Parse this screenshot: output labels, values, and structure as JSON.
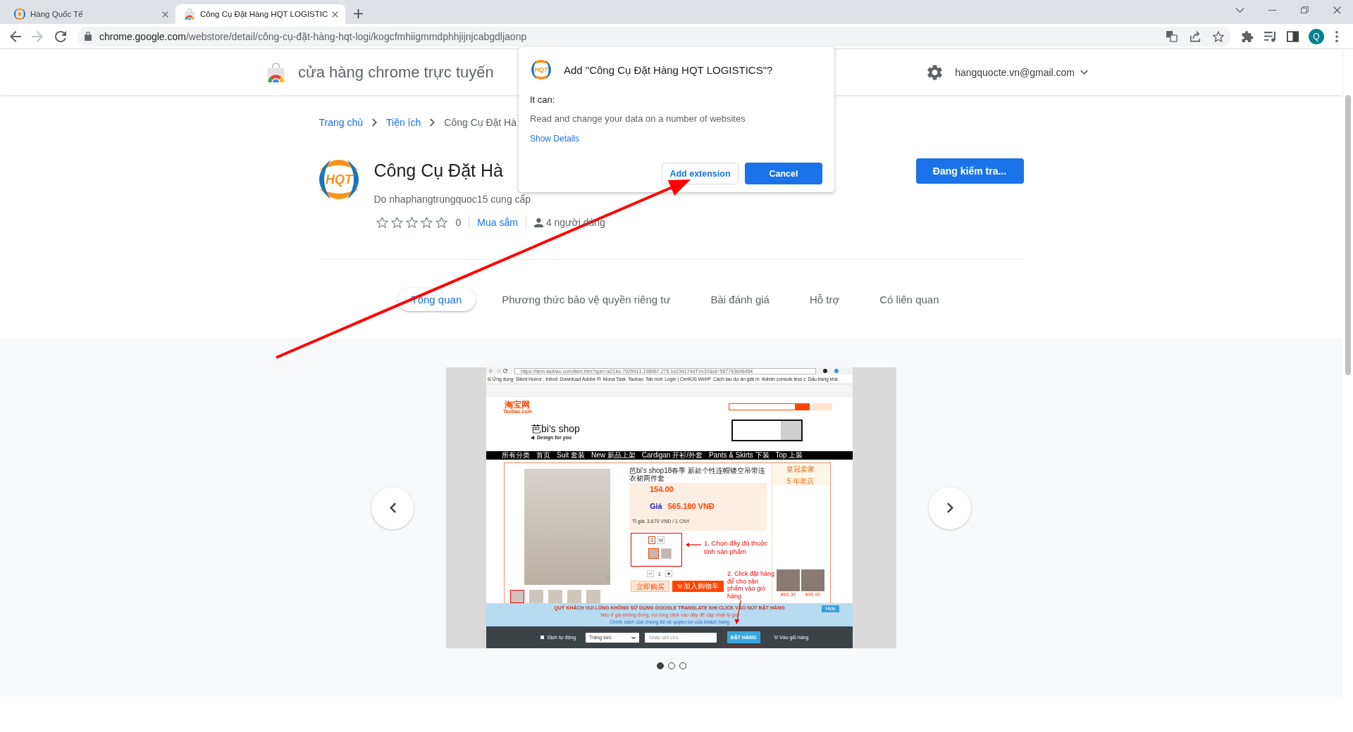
{
  "browser": {
    "tabs": [
      {
        "kind": "site",
        "title": "Hàng Quốc Tế",
        "selected": false
      },
      {
        "kind": "store",
        "title": "Công Cụ Đặt Hàng HQT LOGISTIC",
        "selected": true
      }
    ],
    "address": {
      "host": "chrome.google.com",
      "path": "/webstore/detail/công-cụ-đặt-hàng-hqt-logi/kogcfmhiigmmdphhjijnjcabgdljaonp"
    },
    "profile_initial": "Q"
  },
  "store_header": {
    "title": "cửa hàng chrome trực tuyến",
    "account": "hangquocte.vn@gmail.com"
  },
  "breadcrumb": [
    {
      "kind": "link",
      "label": "Trang chủ"
    },
    {
      "kind": "link",
      "label": "Tiện ích"
    },
    {
      "kind": "current",
      "label": "Công Cụ Đặt Hà"
    }
  ],
  "extension": {
    "logo_text": "HQT",
    "name": "Công Cụ Đặt Hà",
    "publisher": "Do nhaphangtrungquoc15 cung cấp",
    "stars": 0,
    "rating_count": "0",
    "category": "Mua sắm",
    "users": "4 người dùng",
    "action_button": "Đang kiểm tra..."
  },
  "detail_tabs": [
    {
      "label": "Tổng quan",
      "selected": true
    },
    {
      "label": "Phương thức bảo vệ quyền riêng tư",
      "selected": false
    },
    {
      "label": "Bài đánh giá",
      "selected": false
    },
    {
      "label": "Hỗ trợ",
      "selected": false
    },
    {
      "label": "Có liên quan",
      "selected": false
    }
  ],
  "carousel": {
    "slides": [
      {
        "selected": true
      },
      {
        "selected": false
      },
      {
        "selected": false
      }
    ],
    "screenshot": {
      "url": "https://item.taobao.com/item.htm?spm=a21bo.7929913.198967.275.1e234174dTVv3X&id=567743646454",
      "bookmarks": [
        {
          "kind": "apps",
          "label": "Ứng dụng"
        },
        {
          "kind": "site",
          "label": "Silent Horror : Introd"
        },
        {
          "kind": "site",
          "label": "Download Adobe Fl"
        },
        {
          "kind": "site",
          "label": "Mona Task"
        },
        {
          "kind": "site",
          "label": "Taobao"
        },
        {
          "kind": "site",
          "label": "Tab mới"
        },
        {
          "kind": "site",
          "label": "Login | CentOS WebP"
        },
        {
          "kind": "site",
          "label": "Cách tạo dự án giải m"
        },
        {
          "kind": "site",
          "label": "Admin console less c"
        },
        {
          "kind": "site",
          "label": "Dấu trang khá"
        }
      ],
      "logo": "淘宝网",
      "logo_sub": "Taobao.com",
      "shop_name": "芭bi's shop",
      "shop_tagline": "Design for you",
      "nav": [
        "所有分类",
        "首页",
        "Suit 套装",
        "New 新品上架",
        "Cardigan 开衫/外套",
        "Pants & Skirts 下装",
        "Top 上装"
      ],
      "product_title": "芭bi's shop18春季 新款个性连帽镂空吊带连衣裙两件套",
      "price": "154.00",
      "vnd_label": "Giá",
      "vnd_price": "565.180 VNĐ",
      "rate": "Tỉ giá: 3.670 VND / 1 CNY",
      "sizes": [
        {
          "label": "S",
          "selected": true
        },
        {
          "label": "M",
          "selected": false
        }
      ],
      "colors": [
        {
          "selected": true
        },
        {
          "selected": false
        }
      ],
      "quantity": "1",
      "buy_buttons": [
        {
          "kind": "buy",
          "label": "立即购买"
        },
        {
          "kind": "cart",
          "label": "加入购物车"
        }
      ],
      "thumbnails": [
        {
          "selected": true
        },
        {
          "selected": false
        },
        {
          "selected": false
        },
        {
          "selected": false
        },
        {
          "selected": false
        }
      ],
      "seller_badge": "皇冠卖家",
      "shop_age": "5 年老店",
      "related_prices": [
        "¥69.30",
        "¥99.00"
      ],
      "notes": [
        "1. Chọn đầy đủ thuộc tính sản phẩm",
        "2. Click đặt hàng để cho sản phẩm vào giỏ hàng"
      ],
      "notice": [
        "QUÝ KHÁCH VUI LÒNG KHÔNG SỬ DỤNG GOOGLE TRANSLATE KHI CLICK VÀO NÚT ĐẶT HÀNG",
        "Nếu tỉ giá không đúng, vui lòng click vào đây để cập nhật tỷ giá",
        "Chính sách của chúng tôi về quyền lợi của khách hàng"
      ],
      "hide_button": "Hide",
      "auto_translate": {
        "label": "Dịch tự động",
        "checked": false
      },
      "category_select": "Trang sức",
      "note_placeholder": "Nhập ghi chú",
      "order_button": "ĐẶT HÀNG",
      "cart_link": "Vào giỏ hàng"
    }
  },
  "dialog": {
    "logo_text": "HQT",
    "title": "Add \"Công Cụ Đặt Hàng HQT LOGISTICS\"?",
    "intro": "It can:",
    "permissions": [
      "Read and change your data on a number of websites"
    ],
    "details_link": "Show Details",
    "buttons": [
      {
        "kind": "secondary",
        "label": "Add extension"
      },
      {
        "kind": "primary",
        "label": "Cancel"
      }
    ]
  }
}
